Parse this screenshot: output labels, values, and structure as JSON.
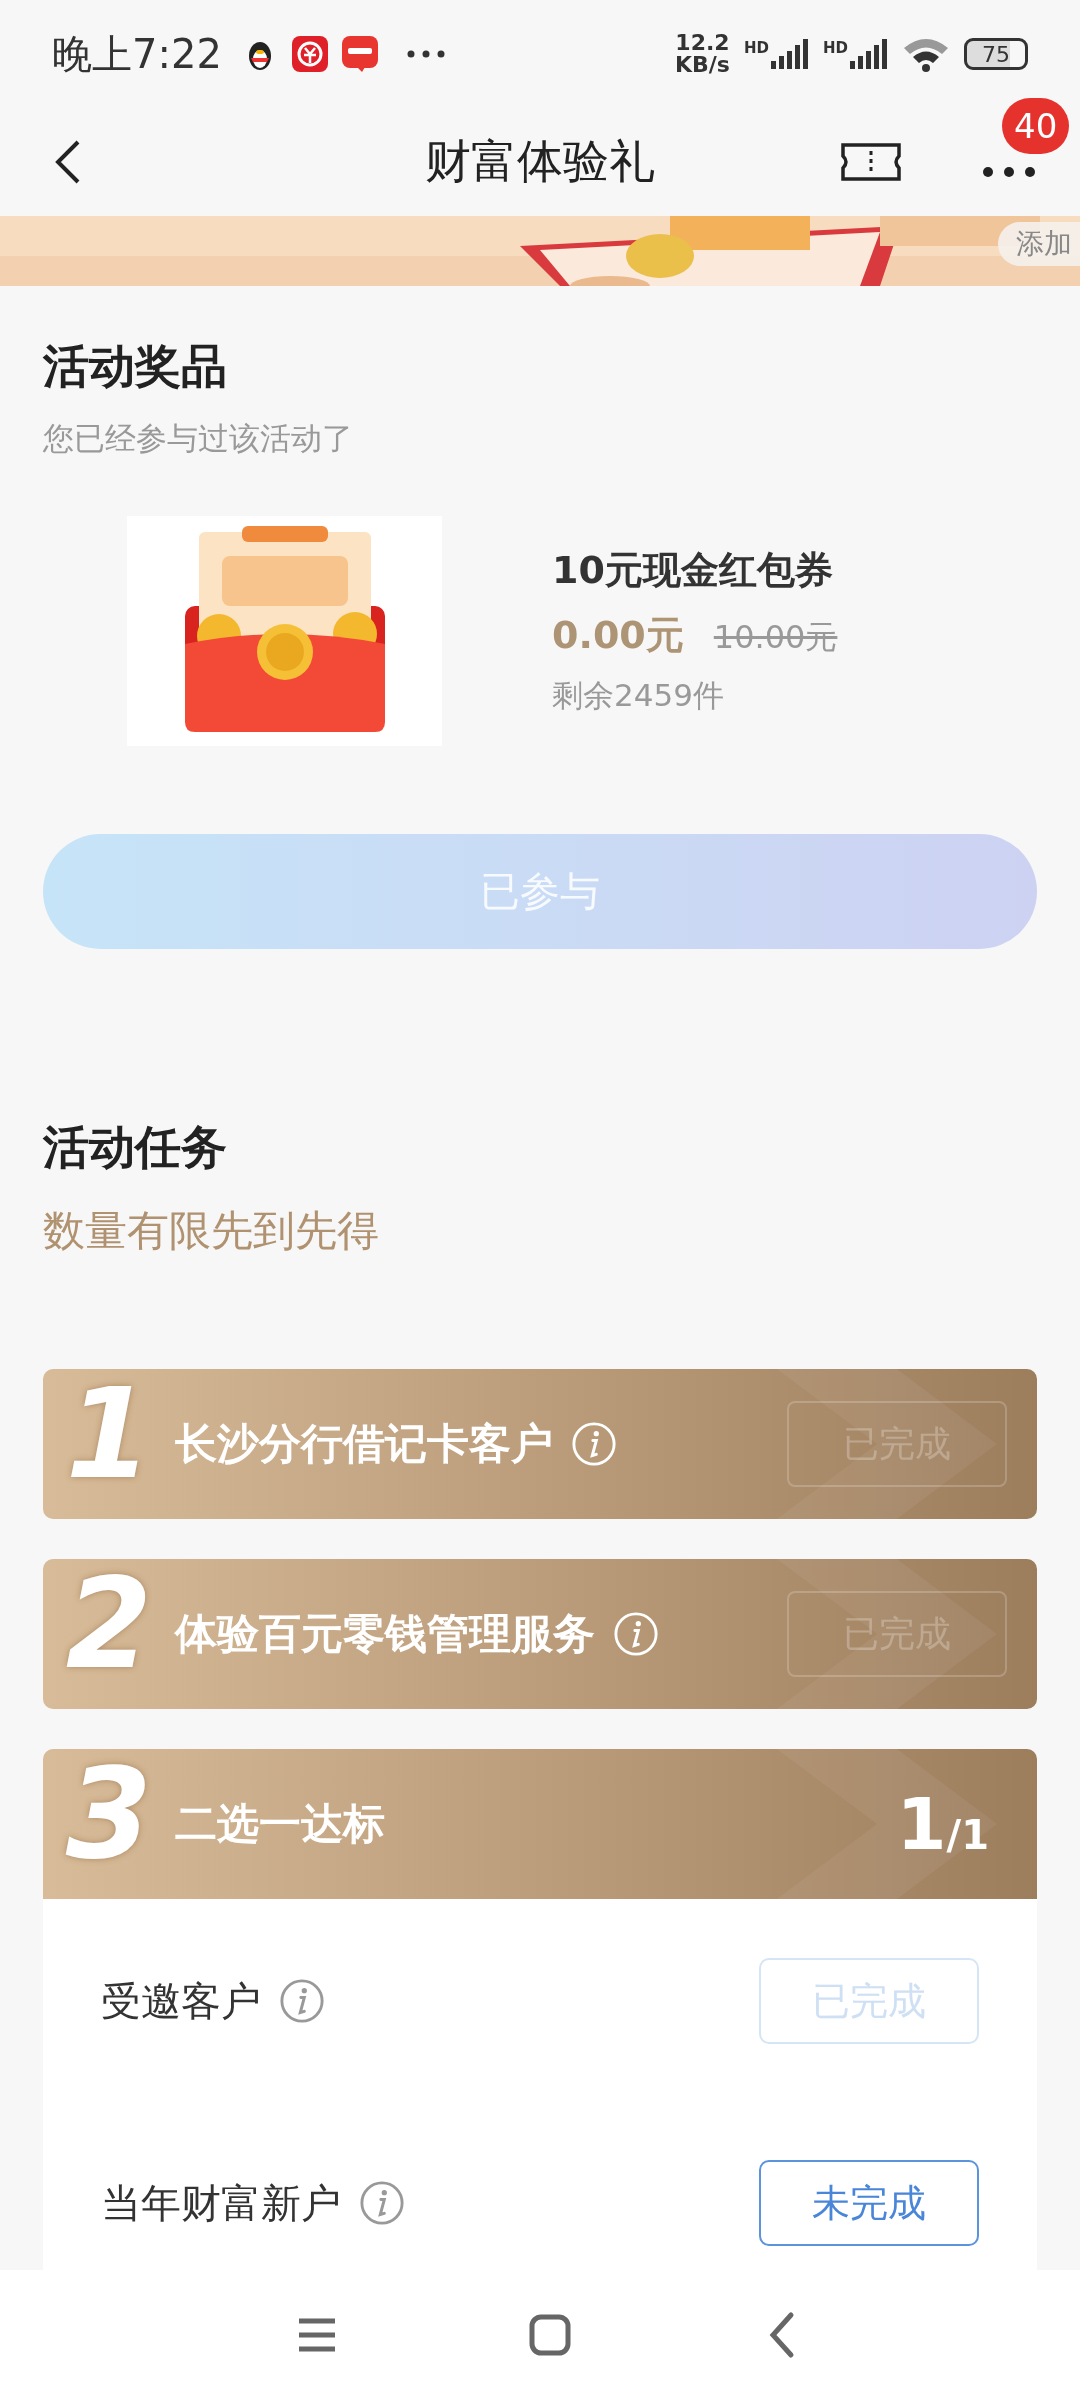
{
  "status_bar": {
    "time": "晚上7:22",
    "net_speed": "12.2",
    "net_unit": "KB/s",
    "signal_labels": [
      "HD",
      "HD"
    ],
    "battery": "75"
  },
  "nav": {
    "title": "财富体验礼",
    "badge": "40"
  },
  "banner": {
    "kind": "picture",
    "chip": "添加"
  },
  "prize_section": {
    "title": "活动奖品",
    "subtitle": "您已经参与过该活动了",
    "prize": {
      "kind": "picture",
      "name": "10元现金红包券",
      "price": "0.00元",
      "original_price": "10.00元",
      "stock": "剩余2459件"
    },
    "button": {
      "label": "已参与",
      "disabled": true
    }
  },
  "task_section": {
    "title": "活动任务",
    "subtitle": "数量有限先到先得",
    "tasks": [
      {
        "kind": "single",
        "number": "1",
        "title": "长沙分行借记卡客户",
        "status": "已完成",
        "completed": true
      },
      {
        "kind": "single",
        "number": "2",
        "title": "体验百元零钱管理服务",
        "status": "已完成",
        "completed": true
      },
      {
        "kind": "choice",
        "number": "3",
        "title": "二选一达标",
        "progress_done": "1",
        "progress_total": "/1",
        "options": [
          {
            "title": "受邀客户",
            "status": "已完成",
            "completed": true
          },
          {
            "title": "当年财富新户",
            "status": "未完成",
            "completed": false
          }
        ]
      }
    ]
  }
}
